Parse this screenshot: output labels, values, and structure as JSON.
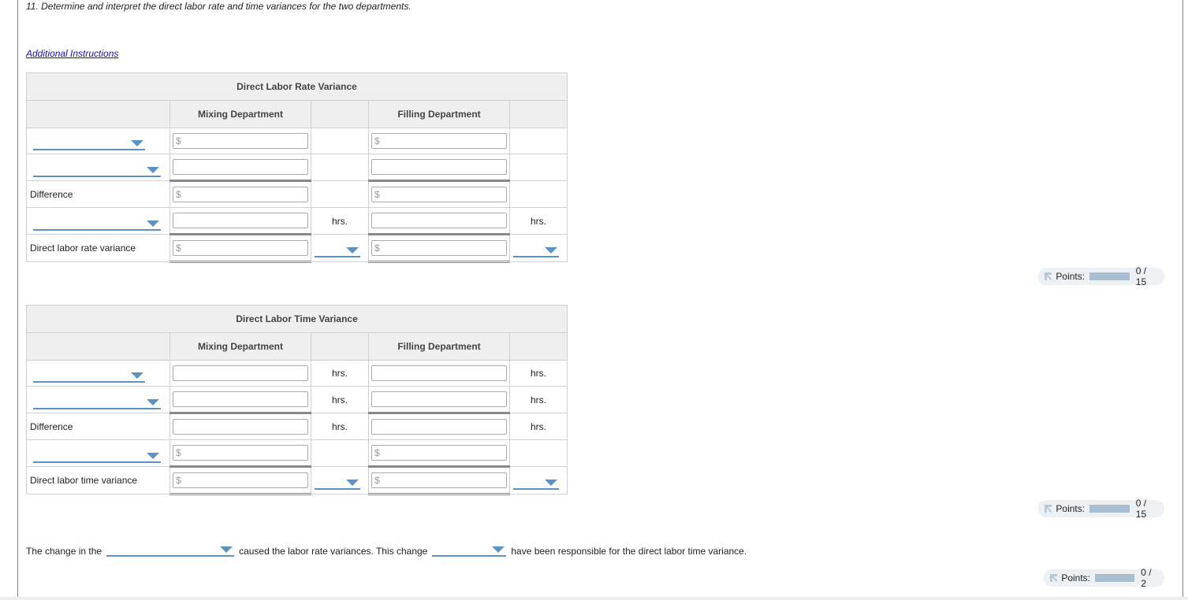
{
  "question": "11. Determine and interpret the direct labor rate and time variances for the two departments.",
  "additional_instructions": "Additional Instructions",
  "rate_table": {
    "title": "Direct Labor Rate Variance",
    "col_mixing": "Mixing Department",
    "col_filling": "Filling Department",
    "rows": [
      {
        "label": "",
        "select": true,
        "mix_prefix": "$",
        "mix_value": "",
        "mix_unit": "",
        "fill_prefix": "$",
        "fill_value": "",
        "fill_unit": ""
      },
      {
        "label": "",
        "select": true,
        "mix_prefix": "",
        "mix_value": "",
        "mix_unit": "",
        "fill_prefix": "",
        "fill_value": "",
        "fill_unit": ""
      },
      {
        "label": "Difference",
        "select": false,
        "mix_prefix": "$",
        "mix_value": "",
        "mix_unit": "",
        "fill_prefix": "$",
        "fill_value": "",
        "fill_unit": ""
      },
      {
        "label": "",
        "select": true,
        "mix_prefix": "",
        "mix_value": "",
        "mix_unit": "hrs.",
        "fill_prefix": "",
        "fill_value": "",
        "fill_unit": "hrs."
      },
      {
        "label": "Direct labor rate variance",
        "select": false,
        "mix_prefix": "$",
        "mix_value": "",
        "mix_unit_select": "",
        "fill_prefix": "$",
        "fill_value": "",
        "fill_unit_select": ""
      }
    ]
  },
  "rate_points": {
    "label": "Points:",
    "value": "0 / 15",
    "progress": 0
  },
  "time_table": {
    "title": "Direct Labor Time Variance",
    "col_mixing": "Mixing Department",
    "col_filling": "Filling Department",
    "rows": [
      {
        "label": "",
        "select": true,
        "mix_prefix": "",
        "mix_value": "",
        "mix_unit": "hrs.",
        "fill_prefix": "",
        "fill_value": "",
        "fill_unit": "hrs."
      },
      {
        "label": "",
        "select": true,
        "mix_prefix": "",
        "mix_value": "",
        "mix_unit": "hrs.",
        "fill_prefix": "",
        "fill_value": "",
        "fill_unit": "hrs."
      },
      {
        "label": "Difference",
        "select": false,
        "mix_prefix": "",
        "mix_value": "",
        "mix_unit": "hrs.",
        "fill_prefix": "",
        "fill_value": "",
        "fill_unit": "hrs."
      },
      {
        "label": "",
        "select": true,
        "mix_prefix": "$",
        "mix_value": "",
        "mix_unit": "",
        "fill_prefix": "$",
        "fill_value": "",
        "fill_unit": ""
      },
      {
        "label": "Direct labor time variance",
        "select": false,
        "mix_prefix": "$",
        "mix_value": "",
        "mix_unit_select": "",
        "fill_prefix": "$",
        "fill_value": "",
        "fill_unit_select": ""
      }
    ]
  },
  "time_points": {
    "label": "Points:",
    "value": "0 / 15",
    "progress": 0
  },
  "interpretation": {
    "part1": "The change in the",
    "select1": "",
    "part2": "caused the labor rate variances. This change",
    "select2": "",
    "part3": "have been responsible for the direct labor time variance."
  },
  "interp_points": {
    "label": "Points:",
    "value": "0 / 2",
    "progress": 0
  },
  "colors": {
    "accent": "#5a93c3",
    "link": "#1a0dab",
    "header_bg": "#efefef",
    "points_bg": "#eef1f4"
  }
}
